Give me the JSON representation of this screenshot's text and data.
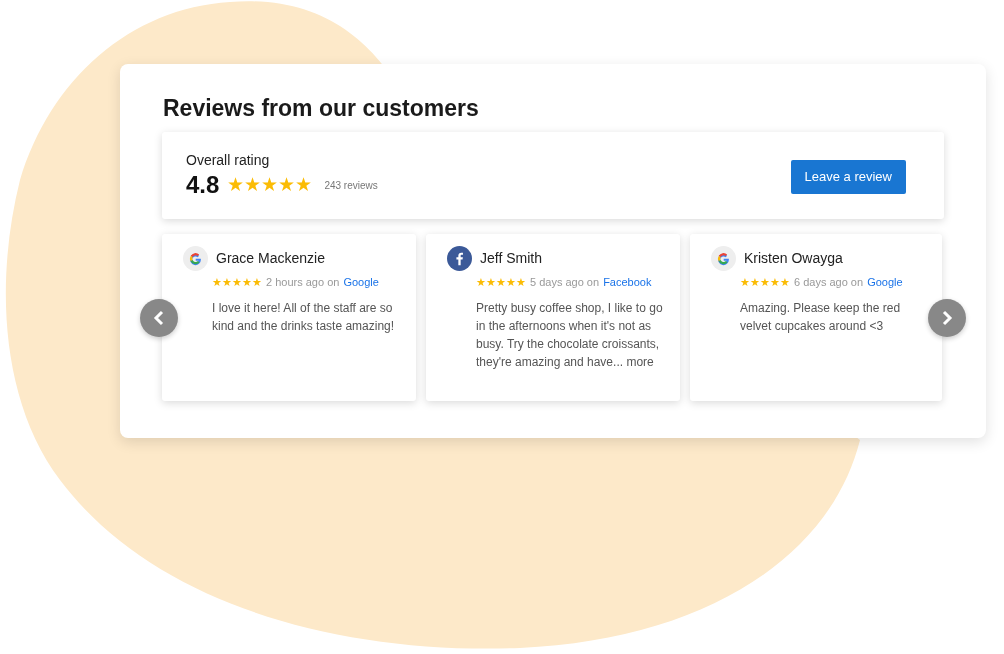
{
  "title": "Reviews from our customers",
  "summary": {
    "label": "Overall rating",
    "score": "4.8",
    "stars": 5,
    "count": "243 reviews",
    "button": "Leave a review"
  },
  "reviews": [
    {
      "name": "Grace Mackenzie",
      "kind": "google",
      "stars": 5,
      "time": "2 hours ago on",
      "source": "Google",
      "text": "I love it here! All of the staff are so kind and the drinks taste amazing!"
    },
    {
      "name": "Jeff Smith",
      "kind": "facebook",
      "stars": 5,
      "time": "5 days ago on",
      "source": "Facebook",
      "text": "Pretty busy coffee shop, I like to go in the afternoons when it's not as busy. Try the chocolate croissants, they're amazing and have... more"
    },
    {
      "name": "Kristen Owayga",
      "kind": "google",
      "stars": 5,
      "time": "6 days ago on",
      "source": "Google",
      "text": "Amazing. Please keep the red velvet cupcakes around <3"
    }
  ]
}
